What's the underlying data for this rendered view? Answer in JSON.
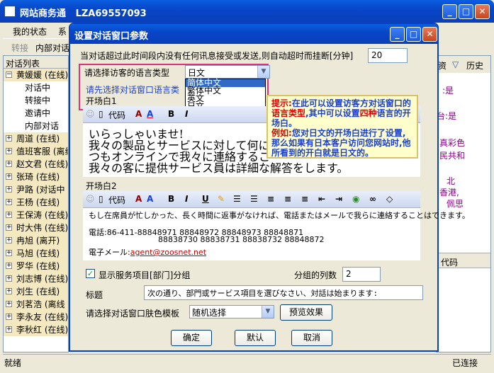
{
  "app": {
    "title": "网站商务通",
    "account": "LZA69557093",
    "menu": [
      "我的状态",
      "系"
    ],
    "toolbar": [
      "转接",
      "内部对话"
    ],
    "left_panel_header": "对话列表",
    "tree": [
      {
        "label": "黄媛媛 (在线)",
        "type": "group",
        "expanded": true
      },
      {
        "label": "对话中",
        "type": "sub"
      },
      {
        "label": "转接中",
        "type": "sub"
      },
      {
        "label": "邀请中",
        "type": "sub"
      },
      {
        "label": "内部对话",
        "type": "sub"
      },
      {
        "label": "周道 (在线)",
        "type": "group"
      },
      {
        "label": "值班客服 (离线",
        "type": "group"
      },
      {
        "label": "赵文君 (在线)",
        "type": "group"
      },
      {
        "label": "张琦 (在线)",
        "type": "group"
      },
      {
        "label": "尹路 (对话中",
        "type": "group"
      },
      {
        "label": "王杨 (在线)",
        "type": "group"
      },
      {
        "label": "王保涛 (在线)",
        "type": "group"
      },
      {
        "label": "时大伟 (在线)",
        "type": "group"
      },
      {
        "label": "冉旭 (离开)",
        "type": "group"
      },
      {
        "label": "马旭 (在线)",
        "type": "group"
      },
      {
        "label": "罗华 (在线)",
        "type": "group"
      },
      {
        "label": "刘志博 (在线)",
        "type": "group"
      },
      {
        "label": "刘生 (在线)",
        "type": "group"
      },
      {
        "label": "刘茗浩 (离线",
        "type": "group"
      },
      {
        "label": "李永友 (在线)",
        "type": "group"
      },
      {
        "label": "李秋红 (在线)",
        "type": "group"
      }
    ],
    "right_tabs": [
      "资",
      "历史"
    ],
    "right_snippets": [
      ":是",
      "台:是",
      "真彩色",
      "民共和",
      "北",
      "香港,",
      "佩思"
    ],
    "right_code_label": "代码",
    "status_left": "就绪",
    "status_right": "已连接"
  },
  "dialog": {
    "title": "设置对话窗口参数",
    "timeout_label": "当对话超过此时间段内没有任何讯息接受或发送,则自动超时而挂断[分钟]",
    "timeout_value": "20",
    "lang_label": "请选择访客的语言类型",
    "lang_selected": "日文",
    "lang_options": [
      "简体中文",
      "繁体中文",
      "英文",
      "日文"
    ],
    "lang_highlighted": "简体中文",
    "hint_link": "请先选择对话窗口语言类",
    "opening1_label": "开场白1",
    "opening2_label": "开场白2",
    "code_label": "代码",
    "opening1_lines": [
      "いらっしゃいませ!",
      "我々の製品とサービスに対して何にか",
      "つもオンラインで我々に連絡するこ",
      "我々の客に提供サービス員は詳細な解答をします。"
    ],
    "opening2_lines": [
      "もし在席員が忙しかった、長く時間に返事がなければ、電話またはメールで我らに連絡することはできます。",
      "電話:86-411-88848971 88848972 88848973 88848871",
      "88838730 88838731 88838732 88848872",
      "電子メール:"
    ],
    "email": "agent@zoosnet.net",
    "show_dept_label": "显示服务项目[部门]分组",
    "show_dept_checked": true,
    "columns_label": "分组的列数",
    "columns_value": "2",
    "heading_label": "标题",
    "heading_value": "次の通り、部門或サービス項目を選びなさい、対話は始まります:",
    "skin_label": "请选择对话窗口肤色模板",
    "skin_value": "随机选择",
    "preview_button": "预览效果",
    "ok_button": "确定",
    "default_button": "默认",
    "cancel_button": "取消"
  },
  "tooltip": {
    "p1_a": "提示:",
    "p1_b": "在此可以设置访客方对话窗口的",
    "p1_c": "语言类型",
    "p1_d": ",其中可以设置",
    "p1_e": "四种",
    "p1_f": "语言的开场白。",
    "p2_a": "例如:",
    "p2_b": "您对日文的开场白进行了设置,那么如果有日本客户访问您网站时,他所看到的开白就是日文的。"
  },
  "colors": {
    "xp_blue": "#0846C8",
    "highlight_pink": "#E0307A",
    "tooltip_red": "#E00000",
    "link_blue": "#1C3FCF"
  }
}
